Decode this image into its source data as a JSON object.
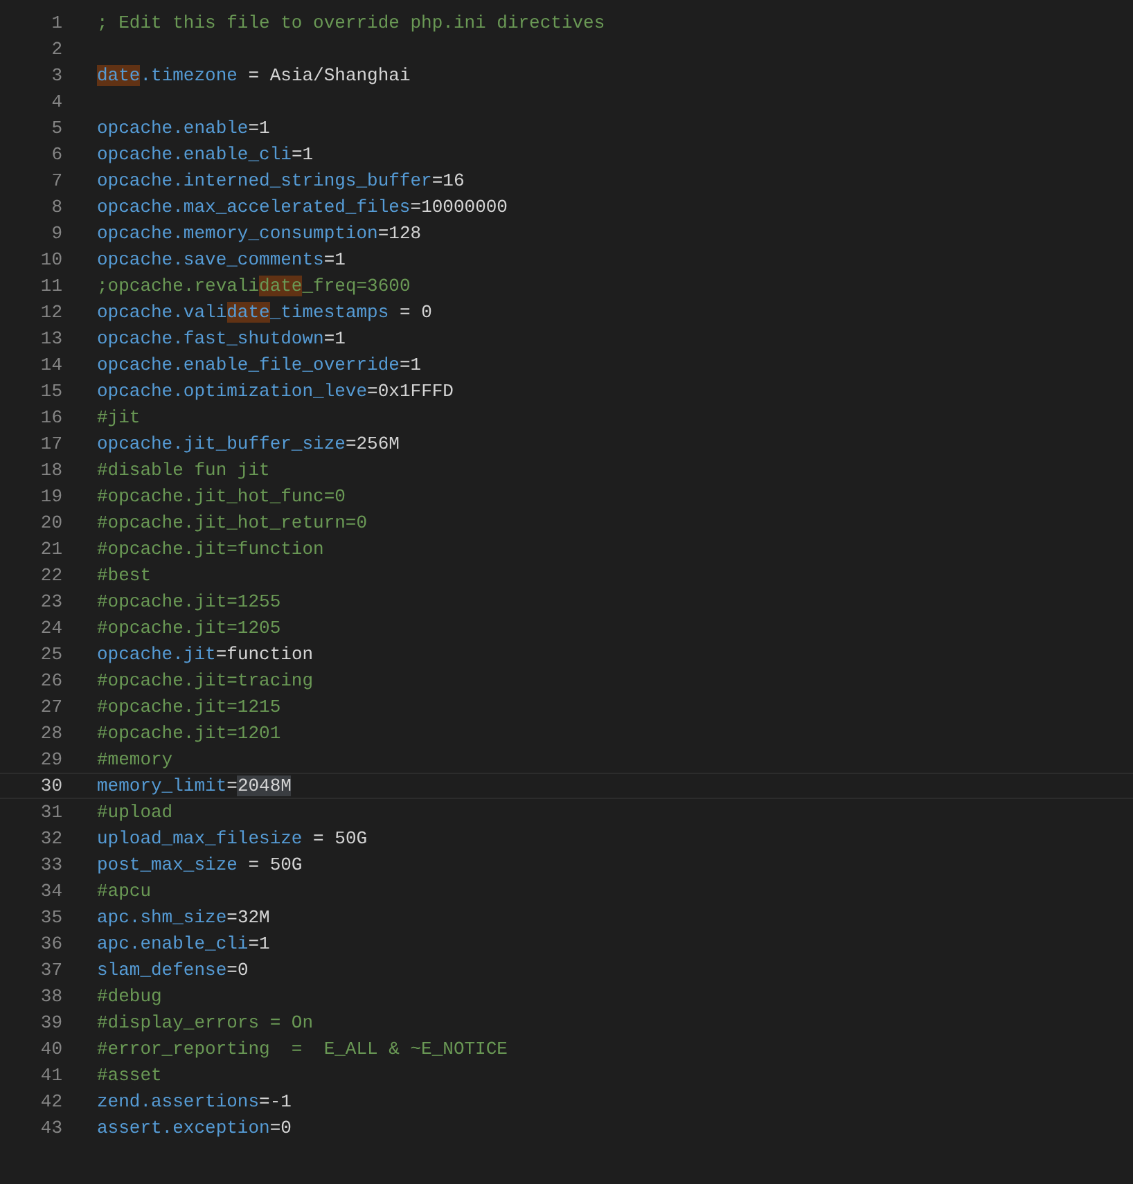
{
  "editor": {
    "lines": [
      {
        "number": "1",
        "current": false,
        "segments": [
          {
            "text": "; Edit this file to override php.ini directives",
            "kind": "comment"
          }
        ]
      },
      {
        "number": "2",
        "current": false
      },
      {
        "number": "3",
        "current": false,
        "segments": [
          {
            "text": "date",
            "kind": "key-match"
          },
          {
            "text": ".timezone",
            "kind": "key"
          },
          {
            "text": " = ",
            "kind": "op"
          },
          {
            "text": "Asia/Shanghai",
            "kind": "value"
          }
        ]
      },
      {
        "number": "4",
        "current": false
      },
      {
        "number": "5",
        "current": false,
        "segments": [
          {
            "text": "opcache.enable",
            "kind": "key"
          },
          {
            "text": "=",
            "kind": "op"
          },
          {
            "text": "1",
            "kind": "value"
          }
        ]
      },
      {
        "number": "6",
        "current": false,
        "segments": [
          {
            "text": "opcache.enable_cli",
            "kind": "key"
          },
          {
            "text": "=",
            "kind": "op"
          },
          {
            "text": "1",
            "kind": "value"
          }
        ]
      },
      {
        "number": "7",
        "current": false,
        "segments": [
          {
            "text": "opcache.interned_strings_buffer",
            "kind": "key"
          },
          {
            "text": "=",
            "kind": "op"
          },
          {
            "text": "16",
            "kind": "value"
          }
        ]
      },
      {
        "number": "8",
        "current": false,
        "segments": [
          {
            "text": "opcache.max_accelerated_files",
            "kind": "key"
          },
          {
            "text": "=",
            "kind": "op"
          },
          {
            "text": "10000000",
            "kind": "value"
          }
        ]
      },
      {
        "number": "9",
        "current": false,
        "segments": [
          {
            "text": "opcache.memory_consumption",
            "kind": "key"
          },
          {
            "text": "=",
            "kind": "op"
          },
          {
            "text": "128",
            "kind": "value"
          }
        ]
      },
      {
        "number": "10",
        "current": false,
        "segments": [
          {
            "text": "opcache.save_comments",
            "kind": "key"
          },
          {
            "text": "=",
            "kind": "op"
          },
          {
            "text": "1",
            "kind": "value"
          }
        ]
      },
      {
        "number": "11",
        "current": false,
        "segments": [
          {
            "text": ";opcache.revali",
            "kind": "comment"
          },
          {
            "text": "date",
            "kind": "comment-match"
          },
          {
            "text": "_freq=3600",
            "kind": "comment"
          }
        ]
      },
      {
        "number": "12",
        "current": false,
        "segments": [
          {
            "text": "opcache.vali",
            "kind": "key"
          },
          {
            "text": "date",
            "kind": "key-match"
          },
          {
            "text": "_timestamps",
            "kind": "key"
          },
          {
            "text": " = ",
            "kind": "op"
          },
          {
            "text": "0",
            "kind": "value"
          }
        ]
      },
      {
        "number": "13",
        "current": false,
        "segments": [
          {
            "text": "opcache.fast_shutdown",
            "kind": "key"
          },
          {
            "text": "=",
            "kind": "op"
          },
          {
            "text": "1",
            "kind": "value"
          }
        ]
      },
      {
        "number": "14",
        "current": false,
        "segments": [
          {
            "text": "opcache.enable_file_override",
            "kind": "key"
          },
          {
            "text": "=",
            "kind": "op"
          },
          {
            "text": "1",
            "kind": "value"
          }
        ]
      },
      {
        "number": "15",
        "current": false,
        "segments": [
          {
            "text": "opcache.optimization_leve",
            "kind": "key"
          },
          {
            "text": "=",
            "kind": "op"
          },
          {
            "text": "0x1FFFD",
            "kind": "value"
          }
        ]
      },
      {
        "number": "16",
        "current": false,
        "segments": [
          {
            "text": "#jit",
            "kind": "comment"
          }
        ]
      },
      {
        "number": "17",
        "current": false,
        "segments": [
          {
            "text": "opcache.jit_buffer_size",
            "kind": "key"
          },
          {
            "text": "=",
            "kind": "op"
          },
          {
            "text": "256M",
            "kind": "value"
          }
        ]
      },
      {
        "number": "18",
        "current": false,
        "segments": [
          {
            "text": "#disable fun jit",
            "kind": "comment"
          }
        ]
      },
      {
        "number": "19",
        "current": false,
        "segments": [
          {
            "text": "#opcache.jit_hot_func=0",
            "kind": "comment"
          }
        ]
      },
      {
        "number": "20",
        "current": false,
        "segments": [
          {
            "text": "#opcache.jit_hot_return=0",
            "kind": "comment"
          }
        ]
      },
      {
        "number": "21",
        "current": false,
        "segments": [
          {
            "text": "#opcache.jit=function",
            "kind": "comment"
          }
        ]
      },
      {
        "number": "22",
        "current": false,
        "segments": [
          {
            "text": "#best",
            "kind": "comment"
          }
        ]
      },
      {
        "number": "23",
        "current": false,
        "segments": [
          {
            "text": "#opcache.jit=1255",
            "kind": "comment"
          }
        ]
      },
      {
        "number": "24",
        "current": false,
        "segments": [
          {
            "text": "#opcache.jit=1205",
            "kind": "comment"
          }
        ]
      },
      {
        "number": "25",
        "current": false,
        "segments": [
          {
            "text": "opcache.jit",
            "kind": "key"
          },
          {
            "text": "=",
            "kind": "op"
          },
          {
            "text": "function",
            "kind": "value"
          }
        ]
      },
      {
        "number": "26",
        "current": false,
        "segments": [
          {
            "text": "#opcache.jit=tracing",
            "kind": "comment"
          }
        ]
      },
      {
        "number": "27",
        "current": false,
        "segments": [
          {
            "text": "#opcache.jit=1215",
            "kind": "comment"
          }
        ]
      },
      {
        "number": "28",
        "current": false,
        "segments": [
          {
            "text": "#opcache.jit=1201",
            "kind": "comment"
          }
        ]
      },
      {
        "number": "29",
        "current": false,
        "segments": [
          {
            "text": "#memory",
            "kind": "comment"
          }
        ]
      },
      {
        "number": "30",
        "current": true,
        "segments": [
          {
            "text": "memory_limit",
            "kind": "key"
          },
          {
            "text": "=",
            "kind": "op"
          },
          {
            "text": "2048M",
            "kind": "value-selected"
          }
        ]
      },
      {
        "number": "31",
        "current": false,
        "segments": [
          {
            "text": "#upload",
            "kind": "comment"
          }
        ]
      },
      {
        "number": "32",
        "current": false,
        "segments": [
          {
            "text": "upload_max_filesize",
            "kind": "key"
          },
          {
            "text": " = ",
            "kind": "op"
          },
          {
            "text": "50G",
            "kind": "value"
          }
        ]
      },
      {
        "number": "33",
        "current": false,
        "segments": [
          {
            "text": "post_max_size",
            "kind": "key"
          },
          {
            "text": " = ",
            "kind": "op"
          },
          {
            "text": "50G",
            "kind": "value"
          }
        ]
      },
      {
        "number": "34",
        "current": false,
        "segments": [
          {
            "text": "#apcu",
            "kind": "comment"
          }
        ]
      },
      {
        "number": "35",
        "current": false,
        "segments": [
          {
            "text": "apc.shm_size",
            "kind": "key"
          },
          {
            "text": "=",
            "kind": "op"
          },
          {
            "text": "32M",
            "kind": "value"
          }
        ]
      },
      {
        "number": "36",
        "current": false,
        "segments": [
          {
            "text": "apc.enable_cli",
            "kind": "key"
          },
          {
            "text": "=",
            "kind": "op"
          },
          {
            "text": "1",
            "kind": "value"
          }
        ]
      },
      {
        "number": "37",
        "current": false,
        "segments": [
          {
            "text": "slam_defense",
            "kind": "key"
          },
          {
            "text": "=",
            "kind": "op"
          },
          {
            "text": "0",
            "kind": "value"
          }
        ]
      },
      {
        "number": "38",
        "current": false,
        "segments": [
          {
            "text": "#debug",
            "kind": "comment"
          }
        ]
      },
      {
        "number": "39",
        "current": false,
        "segments": [
          {
            "text": "#display_errors = On",
            "kind": "comment"
          }
        ]
      },
      {
        "number": "40",
        "current": false,
        "segments": [
          {
            "text": "#error_reporting  =  E_ALL & ~E_NOTICE",
            "kind": "comment"
          }
        ]
      },
      {
        "number": "41",
        "current": false,
        "segments": [
          {
            "text": "#asset",
            "kind": "comment"
          }
        ]
      },
      {
        "number": "42",
        "current": false,
        "segments": [
          {
            "text": "zend.assertions",
            "kind": "key"
          },
          {
            "text": "=",
            "kind": "op"
          },
          {
            "text": "-1",
            "kind": "value"
          }
        ]
      },
      {
        "number": "43",
        "current": false,
        "segments": [
          {
            "text": "assert.exception",
            "kind": "key"
          },
          {
            "text": "=",
            "kind": "op"
          },
          {
            "text": "0",
            "kind": "value"
          }
        ]
      }
    ]
  }
}
